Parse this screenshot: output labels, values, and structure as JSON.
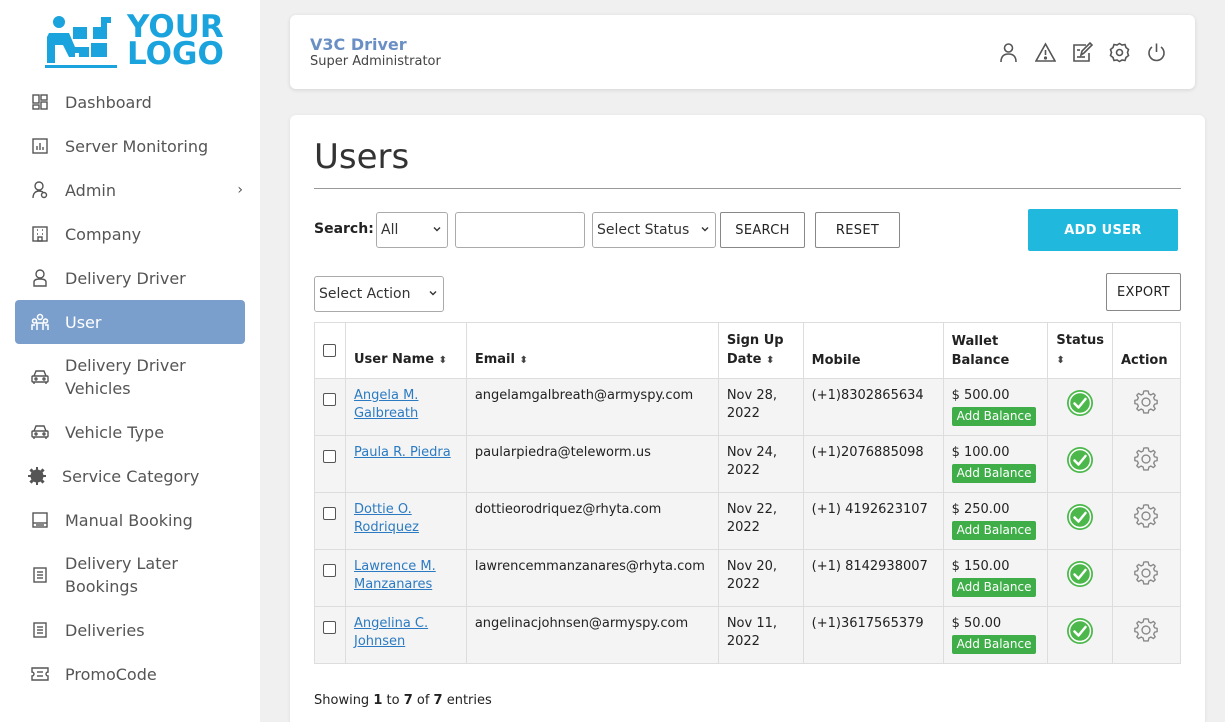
{
  "logo": {
    "line1": "YOUR",
    "line2": "LOGO"
  },
  "sidebar": {
    "items": [
      {
        "label": "Dashboard"
      },
      {
        "label": "Server Monitoring"
      },
      {
        "label": "Admin"
      },
      {
        "label": "Company"
      },
      {
        "label": "Delivery Driver"
      },
      {
        "label": "User"
      },
      {
        "label": "Delivery Driver\nVehicles"
      },
      {
        "label": "Vehicle Type"
      },
      {
        "label": "Service Category"
      },
      {
        "label": "Manual Booking"
      },
      {
        "label": "Delivery Later\nBookings"
      },
      {
        "label": "Deliveries"
      },
      {
        "label": "PromoCode"
      }
    ],
    "active_index": 5,
    "admin_chevron": "›"
  },
  "header": {
    "title": "V3C Driver",
    "subtitle": "Super Administrator",
    "icons": [
      "user-icon",
      "warning-icon",
      "edit-icon",
      "settings-icon",
      "power-icon"
    ]
  },
  "main": {
    "title": "Users",
    "search": {
      "label": "Search:",
      "scope_value": "All",
      "text_value": "",
      "status_value": "Select Status",
      "search_button": "SEARCH",
      "reset_button": "RESET",
      "add_user_button": "ADD USER"
    },
    "action_select": "Select Action",
    "export_button": "EXPORT",
    "table": {
      "headers": {
        "username": "User Name",
        "email": "Email",
        "signup_line1": "Sign Up",
        "signup_line2": "Date",
        "mobile": "Mobile",
        "wallet_line1": "Wallet",
        "wallet_line2": "Balance",
        "status": "Status",
        "action": "Action",
        "sort_glyph": "⬍"
      },
      "add_balance_label": "Add Balance",
      "rows": [
        {
          "name1": "Angela M.",
          "name2": "Galbreath",
          "email": "angelamgalbreath@armyspy.com",
          "date1": "Nov 28,",
          "date2": "2022",
          "mobile": "(+1)8302865634",
          "wallet": "$ 500.00"
        },
        {
          "name1": "Paula R. Piedra",
          "name2": "",
          "email": "paularpiedra@teleworm.us",
          "date1": "Nov 24,",
          "date2": "2022",
          "mobile": "(+1)2076885098",
          "wallet": "$ 100.00"
        },
        {
          "name1": "Dottie O.",
          "name2": "Rodriquez",
          "email": "dottieorodriquez@rhyta.com",
          "date1": "Nov 22,",
          "date2": "2022",
          "mobile": "(+1) 4192623107",
          "wallet": "$ 250.00"
        },
        {
          "name1": "Lawrence M.",
          "name2": "Manzanares",
          "email": "lawrencemmanzanares@rhyta.com",
          "date1": "Nov 20,",
          "date2": "2022",
          "mobile": "(+1) 8142938007",
          "wallet": "$ 150.00"
        },
        {
          "name1": "Angelina C.",
          "name2": "Johnsen",
          "email": "angelinacjohnsen@armyspy.com",
          "date1": "Nov 11,",
          "date2": "2022",
          "mobile": "(+1)3617565379",
          "wallet": "$ 50.00"
        }
      ]
    },
    "footer": {
      "prefix": "Showing ",
      "from": "1",
      "to_word": " to ",
      "to": "7",
      "of_word": " of ",
      "total": "7",
      "suffix": " entries"
    }
  },
  "colors": {
    "brand": "#1aa3dd",
    "active_nav": "#7a9fcc",
    "primary_button": "#21b8de",
    "add_balance": "#3fae49",
    "status_ok": "#4cb84c",
    "link": "#2c7bc2"
  }
}
